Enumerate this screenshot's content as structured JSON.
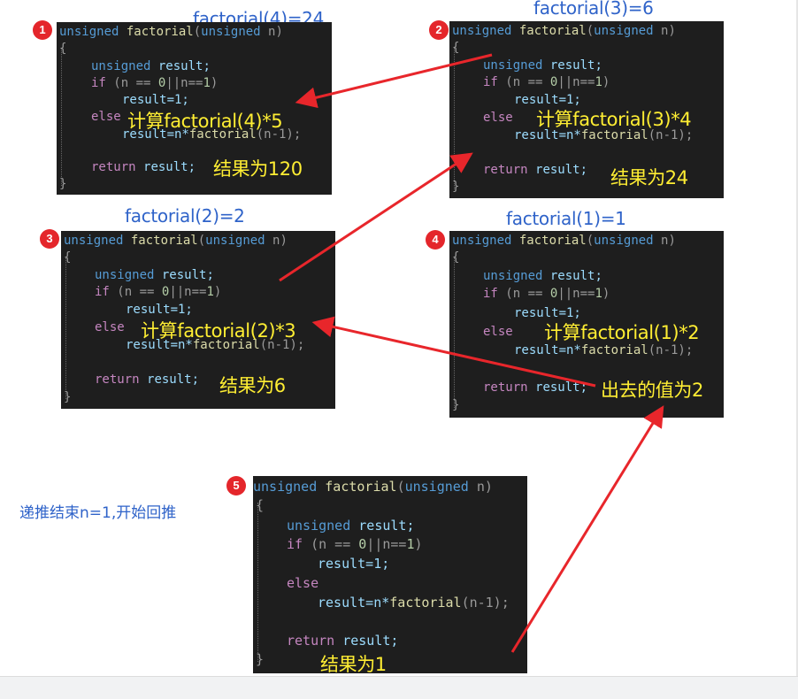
{
  "colors": {
    "title_blue": "#2f63c9",
    "annotation_yellow": "#ffee33",
    "arrow_red": "#e8262b",
    "panel_bg": "#1e1e1e"
  },
  "code": {
    "line1_type": "unsigned",
    "line1_fn": "factorial",
    "line1_paren_open": "(",
    "line1_param_type": "unsigned",
    "line1_param": "n",
    "line1_paren_close": ")",
    "brace_open": "{",
    "decl_type": "unsigned",
    "decl_var": "result;",
    "if_kw": "if",
    "if_cond_a": "(n == ",
    "if_zero": "0",
    "if_cond_b": "||n==",
    "if_one": "1",
    "if_close": ")",
    "assign_one": "result=1;",
    "else_kw": "else",
    "recur_a": "result=n*",
    "recur_fn": "factorial",
    "recur_b": "(n-1);",
    "return_kw": "return",
    "return_var": "result;",
    "brace_close": "}"
  },
  "panels": [
    {
      "badge": "1",
      "title": "factorial(4)=24",
      "calc_note": "计算factorial(4)*5",
      "result_note": "结果为120"
    },
    {
      "badge": "2",
      "title": "factorial(3)=6",
      "calc_note": "计算factorial(3)*4",
      "result_note": "结果为24"
    },
    {
      "badge": "3",
      "title": "factorial(2)=2",
      "calc_note": "计算factorial(2)*3",
      "result_note": "结果为6"
    },
    {
      "badge": "4",
      "title": "factorial(1)=1",
      "calc_note": "计算factorial(1)*2",
      "result_note": "出去的值为2"
    },
    {
      "badge": "5",
      "title": "",
      "calc_note": "",
      "result_note": "结果为1"
    }
  ],
  "side_note": "递推结束n=1,开始回推"
}
